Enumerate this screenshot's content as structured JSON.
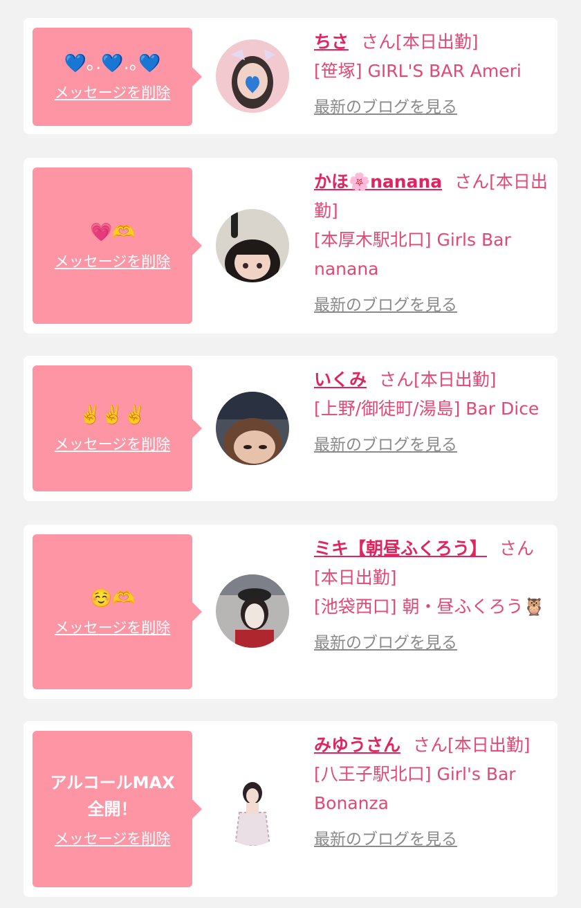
{
  "items": [
    {
      "message": "💙｡.💙.｡💙",
      "delete_label": "メッセージを削除",
      "name": "ちさ",
      "status": "さん[本日出勤]",
      "shop": "[笹塚] GIRL'S BAR Ameri",
      "blog_label": "最新のブログを見る"
    },
    {
      "message": "💗🫶",
      "delete_label": "メッセージを削除",
      "name": "かほ🌸nanana",
      "status": "さん[本日出勤]",
      "shop": "[本厚木駅北口] Girls Bar nanana",
      "blog_label": "最新のブログを見る"
    },
    {
      "message": "✌️✌️✌️",
      "delete_label": "メッセージを削除",
      "name": "いくみ",
      "status": "さん[本日出勤]",
      "shop": "[上野/御徒町/湯島] Bar Dice",
      "blog_label": "最新のブログを見る"
    },
    {
      "message": "☺️🫶",
      "delete_label": "メッセージを削除",
      "name": "ミキ【朝昼ふくろう】",
      "status": "さん[本日出勤]",
      "shop": "[池袋西口] 朝・昼ふくろう🦉",
      "blog_label": "最新のブログを見る"
    },
    {
      "message": "アルコールMAX全開！",
      "delete_label": "メッセージを削除",
      "name": "みゆうさん",
      "status": "さん[本日出勤]",
      "shop": "[八王子駅北口] Girl's Bar Bonanza",
      "blog_label": "最新のブログを見る"
    }
  ]
}
